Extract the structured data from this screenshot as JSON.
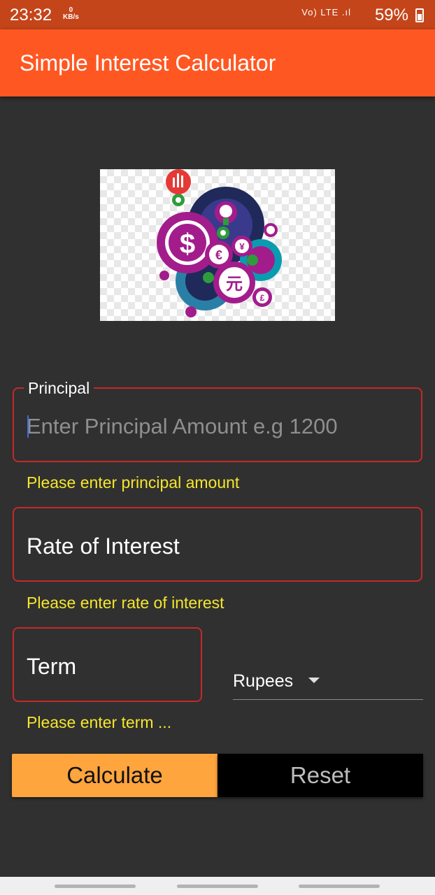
{
  "status": {
    "time": "23:32",
    "kbs_value": "0",
    "kbs_unit": "KB/s",
    "net_icons": "Vo) LTE .ıl",
    "battery": "59%"
  },
  "app_bar": {
    "title": "Simple Interest Calculator"
  },
  "principal": {
    "label": "Principal",
    "placeholder": "Enter Principal Amount e.g 1200",
    "error": "Please enter principal amount"
  },
  "rate": {
    "label": "Rate of Interest",
    "error": "Please enter rate of interest"
  },
  "term": {
    "label": "Term",
    "error": "Please enter term ..."
  },
  "currency": {
    "selected": "Rupees"
  },
  "buttons": {
    "calculate": "Calculate",
    "reset": "Reset"
  },
  "colors": {
    "app_bar": "#ff5722",
    "status_bar": "#c5451a",
    "error_border": "#c62828",
    "error_text": "#f5e62b",
    "calculate_bg": "#ffa53e",
    "reset_bg": "#000000"
  }
}
